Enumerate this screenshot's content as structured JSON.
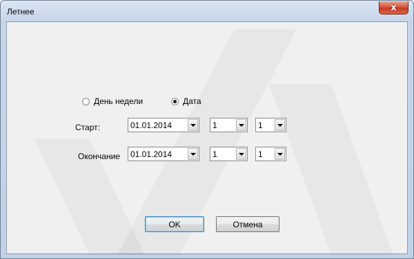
{
  "window": {
    "title": "Летнее",
    "close_glyph": "x"
  },
  "mode": {
    "options": [
      {
        "label": "День недели",
        "checked": false
      },
      {
        "label": "Дата",
        "checked": true
      }
    ]
  },
  "start": {
    "label": "Старт:",
    "date": "01.01.2014",
    "combo2": "1",
    "combo3": "1"
  },
  "end": {
    "label": "Окончание",
    "date": "01.01.2014",
    "combo2": "1",
    "combo3": "1"
  },
  "buttons": {
    "ok": "OK",
    "cancel": "Отмена"
  },
  "colors": {
    "frame": "#c2d2e6",
    "client": "#f0f0f0",
    "close": "#c43c21",
    "default_button_border": "#3c7fb1"
  }
}
